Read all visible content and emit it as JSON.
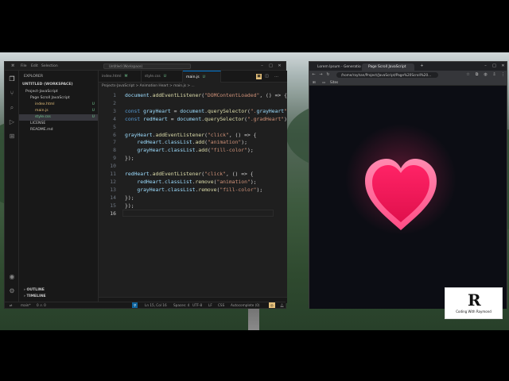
{
  "vscode": {
    "title": "Untitled (Workspace)",
    "menus": [
      "File",
      "Edit",
      "Selection"
    ],
    "explorer": {
      "header": "EXPLORER",
      "workspace": "UNTITLED (WORKSPACE)",
      "items": [
        {
          "label": "Project-JavaScript",
          "badge": ""
        },
        {
          "label": "Page Scroll JavaScript",
          "badge": ""
        },
        {
          "label": "index.html",
          "badge": "U"
        },
        {
          "label": "main.js",
          "badge": "U"
        },
        {
          "label": "style.css",
          "badge": "U"
        },
        {
          "label": "LICENSE",
          "badge": ""
        },
        {
          "label": "README.md",
          "badge": ""
        }
      ],
      "outline": "OUTLINE",
      "timeline": "TIMELINE"
    },
    "tabs": [
      {
        "label": "index.html",
        "mark": "M"
      },
      {
        "label": "style.css",
        "mark": "U"
      },
      {
        "label": "main.js",
        "mark": "U"
      }
    ],
    "breadcrumb": "Projects-JavaScript > Animation Heart > main.js > ...",
    "code": [
      "document.addEventListener(\"DOMContentLoaded\", () => {",
      "",
      "const grayHeart = document.querySelector(\".grayHeart\");",
      "const redHeart = document.querySelector(\".gradHeart\");",
      "",
      "grayHeart.addEventListener(\"click\", () => {",
      "    redHeart.classList.add(\"animation\");",
      "    grayHeart.classList.add(\"fill-color\");",
      "});",
      "",
      "redHeart.addEventListener(\"click\", () => {",
      "    redHeart.classList.remove(\"animation\");",
      "    grayHeart.classList.remove(\"fill-color\");",
      "});",
      "});",
      ""
    ],
    "status": {
      "branch": "main*",
      "errors": "0 ⚠ 0",
      "position": "Ln 15, Col 16",
      "spaces": "Spaces: 4",
      "encoding": "UTF-8",
      "eol": "LF",
      "language": "CSS",
      "extension": "Autocomplete (0)"
    }
  },
  "browser": {
    "tabs": [
      {
        "label": "Lorem Ipsum - Generatio"
      },
      {
        "label": "Page Scroll JavaScript"
      }
    ],
    "url": "/home/rayhan/Project/JavaScript/Page%20Scroll%20...",
    "bookmark": "Sites",
    "heart_colors": {
      "outer": "#ff6b9a",
      "inner": "#ff1a5c",
      "glow": "#ff2d6f"
    }
  },
  "watermark": {
    "logo": "R",
    "text": "Coding With Raymond"
  }
}
